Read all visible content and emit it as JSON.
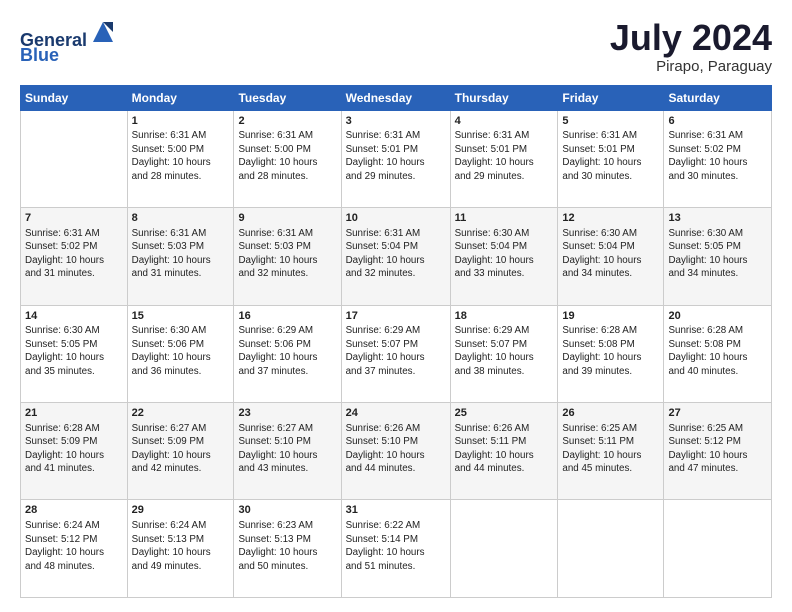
{
  "header": {
    "logo_line1": "General",
    "logo_line2": "Blue",
    "month": "July 2024",
    "location": "Pirapo, Paraguay"
  },
  "weekdays": [
    "Sunday",
    "Monday",
    "Tuesday",
    "Wednesday",
    "Thursday",
    "Friday",
    "Saturday"
  ],
  "weeks": [
    [
      {
        "day": "",
        "info": ""
      },
      {
        "day": "1",
        "info": "Sunrise: 6:31 AM\nSunset: 5:00 PM\nDaylight: 10 hours\nand 28 minutes."
      },
      {
        "day": "2",
        "info": "Sunrise: 6:31 AM\nSunset: 5:00 PM\nDaylight: 10 hours\nand 28 minutes."
      },
      {
        "day": "3",
        "info": "Sunrise: 6:31 AM\nSunset: 5:01 PM\nDaylight: 10 hours\nand 29 minutes."
      },
      {
        "day": "4",
        "info": "Sunrise: 6:31 AM\nSunset: 5:01 PM\nDaylight: 10 hours\nand 29 minutes."
      },
      {
        "day": "5",
        "info": "Sunrise: 6:31 AM\nSunset: 5:01 PM\nDaylight: 10 hours\nand 30 minutes."
      },
      {
        "day": "6",
        "info": "Sunrise: 6:31 AM\nSunset: 5:02 PM\nDaylight: 10 hours\nand 30 minutes."
      }
    ],
    [
      {
        "day": "7",
        "info": "Sunrise: 6:31 AM\nSunset: 5:02 PM\nDaylight: 10 hours\nand 31 minutes."
      },
      {
        "day": "8",
        "info": "Sunrise: 6:31 AM\nSunset: 5:03 PM\nDaylight: 10 hours\nand 31 minutes."
      },
      {
        "day": "9",
        "info": "Sunrise: 6:31 AM\nSunset: 5:03 PM\nDaylight: 10 hours\nand 32 minutes."
      },
      {
        "day": "10",
        "info": "Sunrise: 6:31 AM\nSunset: 5:04 PM\nDaylight: 10 hours\nand 32 minutes."
      },
      {
        "day": "11",
        "info": "Sunrise: 6:30 AM\nSunset: 5:04 PM\nDaylight: 10 hours\nand 33 minutes."
      },
      {
        "day": "12",
        "info": "Sunrise: 6:30 AM\nSunset: 5:04 PM\nDaylight: 10 hours\nand 34 minutes."
      },
      {
        "day": "13",
        "info": "Sunrise: 6:30 AM\nSunset: 5:05 PM\nDaylight: 10 hours\nand 34 minutes."
      }
    ],
    [
      {
        "day": "14",
        "info": "Sunrise: 6:30 AM\nSunset: 5:05 PM\nDaylight: 10 hours\nand 35 minutes."
      },
      {
        "day": "15",
        "info": "Sunrise: 6:30 AM\nSunset: 5:06 PM\nDaylight: 10 hours\nand 36 minutes."
      },
      {
        "day": "16",
        "info": "Sunrise: 6:29 AM\nSunset: 5:06 PM\nDaylight: 10 hours\nand 37 minutes."
      },
      {
        "day": "17",
        "info": "Sunrise: 6:29 AM\nSunset: 5:07 PM\nDaylight: 10 hours\nand 37 minutes."
      },
      {
        "day": "18",
        "info": "Sunrise: 6:29 AM\nSunset: 5:07 PM\nDaylight: 10 hours\nand 38 minutes."
      },
      {
        "day": "19",
        "info": "Sunrise: 6:28 AM\nSunset: 5:08 PM\nDaylight: 10 hours\nand 39 minutes."
      },
      {
        "day": "20",
        "info": "Sunrise: 6:28 AM\nSunset: 5:08 PM\nDaylight: 10 hours\nand 40 minutes."
      }
    ],
    [
      {
        "day": "21",
        "info": "Sunrise: 6:28 AM\nSunset: 5:09 PM\nDaylight: 10 hours\nand 41 minutes."
      },
      {
        "day": "22",
        "info": "Sunrise: 6:27 AM\nSunset: 5:09 PM\nDaylight: 10 hours\nand 42 minutes."
      },
      {
        "day": "23",
        "info": "Sunrise: 6:27 AM\nSunset: 5:10 PM\nDaylight: 10 hours\nand 43 minutes."
      },
      {
        "day": "24",
        "info": "Sunrise: 6:26 AM\nSunset: 5:10 PM\nDaylight: 10 hours\nand 44 minutes."
      },
      {
        "day": "25",
        "info": "Sunrise: 6:26 AM\nSunset: 5:11 PM\nDaylight: 10 hours\nand 44 minutes."
      },
      {
        "day": "26",
        "info": "Sunrise: 6:25 AM\nSunset: 5:11 PM\nDaylight: 10 hours\nand 45 minutes."
      },
      {
        "day": "27",
        "info": "Sunrise: 6:25 AM\nSunset: 5:12 PM\nDaylight: 10 hours\nand 47 minutes."
      }
    ],
    [
      {
        "day": "28",
        "info": "Sunrise: 6:24 AM\nSunset: 5:12 PM\nDaylight: 10 hours\nand 48 minutes."
      },
      {
        "day": "29",
        "info": "Sunrise: 6:24 AM\nSunset: 5:13 PM\nDaylight: 10 hours\nand 49 minutes."
      },
      {
        "day": "30",
        "info": "Sunrise: 6:23 AM\nSunset: 5:13 PM\nDaylight: 10 hours\nand 50 minutes."
      },
      {
        "day": "31",
        "info": "Sunrise: 6:22 AM\nSunset: 5:14 PM\nDaylight: 10 hours\nand 51 minutes."
      },
      {
        "day": "",
        "info": ""
      },
      {
        "day": "",
        "info": ""
      },
      {
        "day": "",
        "info": ""
      }
    ]
  ]
}
